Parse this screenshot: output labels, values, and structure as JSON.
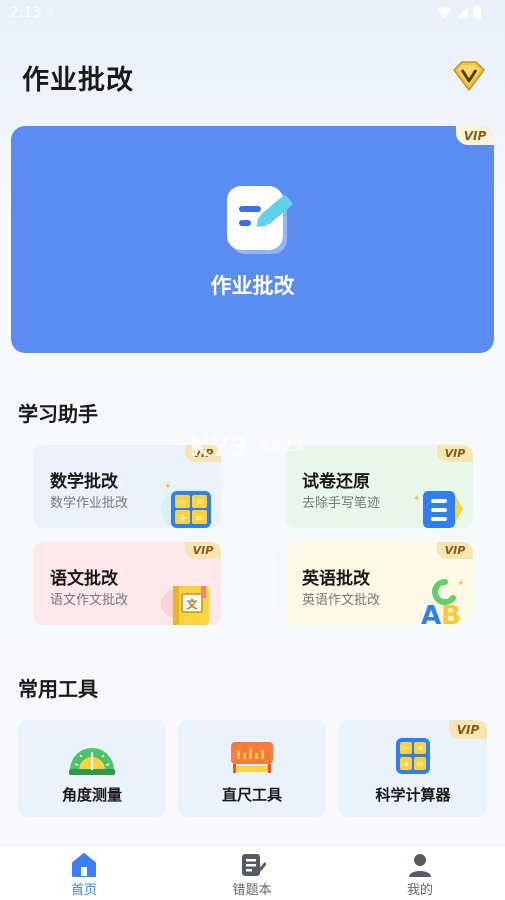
{
  "status_bar": {
    "time": "2:13",
    "hand": "☝"
  },
  "header": {
    "title": "作业批改"
  },
  "hero": {
    "label": "作业批改",
    "vip": "VIP"
  },
  "assistant": {
    "title": "学习助手",
    "cards": [
      {
        "title": "数学批改",
        "subtitle": "数学作业批改",
        "vip": "VIP",
        "bg": "#ecf2fd",
        "icon": "calculator-icon"
      },
      {
        "title": "试卷还原",
        "subtitle": "去除手写笔迹",
        "vip": "VIP",
        "bg": "#eaf8ec",
        "icon": "document-list-icon"
      },
      {
        "title": "语文批改",
        "subtitle": "语文作文批改",
        "vip": "VIP",
        "bg": "#fde9ec",
        "icon": "chinese-book-icon"
      },
      {
        "title": "英语批改",
        "subtitle": "英语作文批改",
        "vip": "VIP",
        "bg": "#fdf9e6",
        "icon": "abc-letters-icon"
      }
    ]
  },
  "tools": {
    "title": "常用工具",
    "items": [
      {
        "label": "角度测量",
        "icon": "protractor-icon"
      },
      {
        "label": "直尺工具",
        "icon": "ruler-icon"
      },
      {
        "label": "科学计算器",
        "icon": "calculator-icon",
        "vip": "VIP"
      }
    ]
  },
  "tabbar": {
    "items": [
      {
        "label": "首页",
        "icon": "home-icon",
        "active": true
      },
      {
        "label": "错题本",
        "icon": "notebook-icon",
        "active": false
      },
      {
        "label": "我的",
        "icon": "user-icon",
        "active": false
      }
    ]
  },
  "watermark": {
    "text": "K73",
    "sub": "游戏之家"
  },
  "colors": {
    "primary": "#5b8cf1",
    "active_tab": "#3b7ef6",
    "vip_bg": "#f7e5b3",
    "vip_text": "#8a5a13"
  }
}
